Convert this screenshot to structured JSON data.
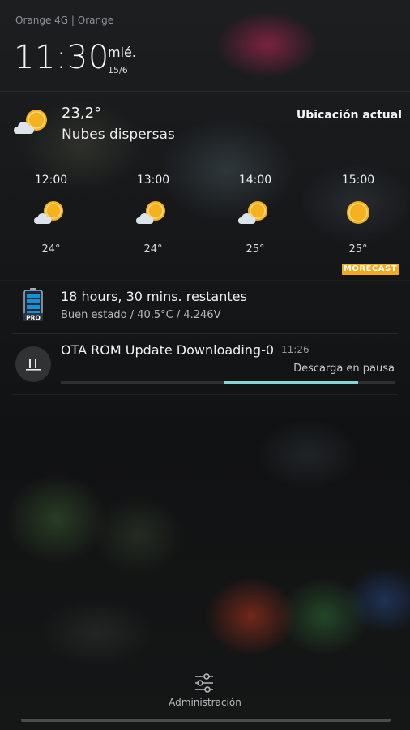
{
  "status": {
    "carrier": "Orange 4G | Orange",
    "time": "11:30",
    "day_name": "mié.",
    "date": "15/6"
  },
  "weather": {
    "current_temp": "23,2°",
    "condition": "Nubes dispersas",
    "location": "Ubicación actual",
    "current_icon": "partly-cloudy-icon",
    "hourly": [
      {
        "time": "12:00",
        "temp": "24°",
        "icon": "partly-cloudy-icon"
      },
      {
        "time": "13:00",
        "temp": "24°",
        "icon": "partly-cloudy-icon"
      },
      {
        "time": "14:00",
        "temp": "25°",
        "icon": "partly-cloudy-icon"
      },
      {
        "time": "15:00",
        "temp": "25°",
        "icon": "sun-icon"
      }
    ],
    "provider_badge": "MORECAST"
  },
  "notifications": {
    "battery": {
      "title": "18 hours, 30 mins. restantes",
      "subtitle": "Buen estado / 40.5°C / 4.246V",
      "icon": "battery-pro-icon",
      "badge": "PRO"
    },
    "download": {
      "title": "OTA ROM Update Downloading-0",
      "time": "11:26",
      "status": "Descarga en pausa",
      "progress_start": 0.49,
      "progress_end": 0.89
    }
  },
  "bottom": {
    "admin_label": "Administración",
    "admin_icon": "sliders-icon"
  },
  "colors": {
    "sun": "#f6b21e",
    "cloud": "#dde3ea",
    "progress": "#86d3cf",
    "badge": "#f4a81c",
    "battery": "#1a8fd6"
  }
}
